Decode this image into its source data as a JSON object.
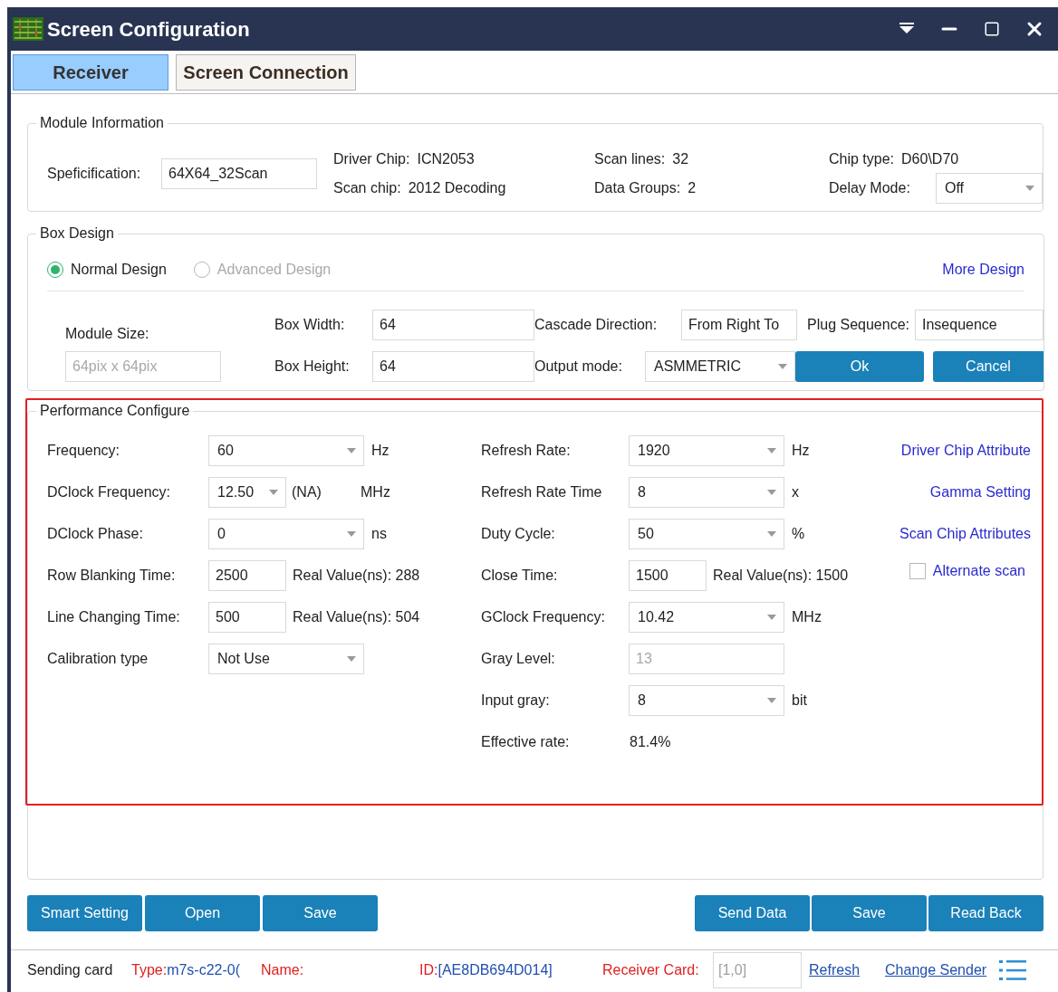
{
  "window": {
    "title": "Screen Configuration"
  },
  "tabs": [
    {
      "label": "Receiver",
      "selected": true
    },
    {
      "label": "Screen Connection",
      "selected": false
    }
  ],
  "module_information": {
    "title": "Module Information",
    "specification": {
      "label": "Speficification:",
      "value": "64X64_32Scan"
    },
    "info_columns": [
      [
        {
          "label": "Driver Chip:",
          "value": "ICN2053"
        },
        {
          "label": "Scan chip:",
          "value": "2012 Decoding"
        }
      ],
      [
        {
          "label": "Scan lines:",
          "value": "32"
        },
        {
          "label": "Data Groups:",
          "value": "2"
        }
      ]
    ],
    "chip_type": {
      "label": "Chip type:",
      "value": "D60\\D70"
    },
    "delay_mode": {
      "label": "Delay Mode:",
      "value": "Off"
    }
  },
  "box_design": {
    "title": "Box Design",
    "design_modes": [
      {
        "label": "Normal Design",
        "selected": true,
        "disabled": false
      },
      {
        "label": "Advanced Design",
        "selected": false,
        "disabled": true
      }
    ],
    "more_link": "More Design",
    "module_size": {
      "label": "Module Size:",
      "value": "64pix x 64pix",
      "disabled": true
    },
    "box_width": {
      "label": "Box Width:",
      "value": "64"
    },
    "box_height": {
      "label": "Box Height:",
      "value": "64"
    },
    "cascade_direction": {
      "label": "Cascade Direction:",
      "value": "From Right To"
    },
    "plug_sequence": {
      "label": "Plug Sequence:",
      "value": "Insequence"
    },
    "output_mode": {
      "label": "Output mode:",
      "value": "ASMMETRIC"
    },
    "buttons": [
      "Ok",
      "Cancel"
    ]
  },
  "performance": {
    "title": "Performance Configure",
    "left_rows": [
      {
        "label": "Frequency:",
        "kind": "select",
        "value": "60",
        "unit": "Hz"
      },
      {
        "label": "DClock Frequency:",
        "kind": "short_select",
        "value": "12.50",
        "note": "(NA)",
        "unit": "MHz"
      },
      {
        "label": "DClock Phase:",
        "kind": "select",
        "value": "0",
        "unit": "ns"
      },
      {
        "label": "Row Blanking Time:",
        "kind": "input",
        "value": "2500",
        "note": "Real Value(ns): 288"
      },
      {
        "label": "Line Changing Time:",
        "kind": "input",
        "value": "500",
        "note": "Real Value(ns): 504"
      },
      {
        "label": "Calibration type",
        "kind": "select",
        "value": "Not Use"
      }
    ],
    "right_rows": [
      {
        "label": "Refresh Rate:",
        "kind": "select",
        "value": "1920",
        "unit": "Hz"
      },
      {
        "label": "Refresh Rate Time",
        "kind": "select",
        "value": "8",
        "unit": "x"
      },
      {
        "label": "Duty Cycle:",
        "kind": "select",
        "value": "50",
        "unit": "%"
      },
      {
        "label": "Close Time:",
        "kind": "input",
        "value": "1500",
        "note": "Real Value(ns): 1500"
      },
      {
        "label": "GClock Frequency:",
        "kind": "select",
        "value": "10.42",
        "unit": "MHz"
      },
      {
        "label": "Gray Level:",
        "kind": "wide_input",
        "value": "13",
        "disabled": true
      },
      {
        "label": "Input gray:",
        "kind": "select",
        "value": "8",
        "unit": "bit"
      },
      {
        "label": "Effective rate:",
        "kind": "text",
        "value": "81.4%"
      }
    ],
    "links": [
      "Driver Chip Attribute",
      "Gamma Setting",
      "Scan Chip Attributes"
    ],
    "alternate_scan": {
      "label": "Alternate scan",
      "checked": false
    }
  },
  "buttons_left": [
    "Smart Setting",
    "Open",
    "Save"
  ],
  "buttons_right": [
    "Send Data",
    "Save",
    "Read Back"
  ],
  "status_bar": {
    "lead": "Sending card",
    "pairs": [
      {
        "label": "Type:",
        "value": "m7s-c22-0("
      },
      {
        "label": "Name:"
      },
      {
        "label": "ID:",
        "value": "[AE8DB694D014]"
      },
      {
        "label": "Receiver Card:"
      }
    ],
    "receiver_card": "[1,0]",
    "links": [
      "Refresh",
      "Change Sender"
    ]
  }
}
